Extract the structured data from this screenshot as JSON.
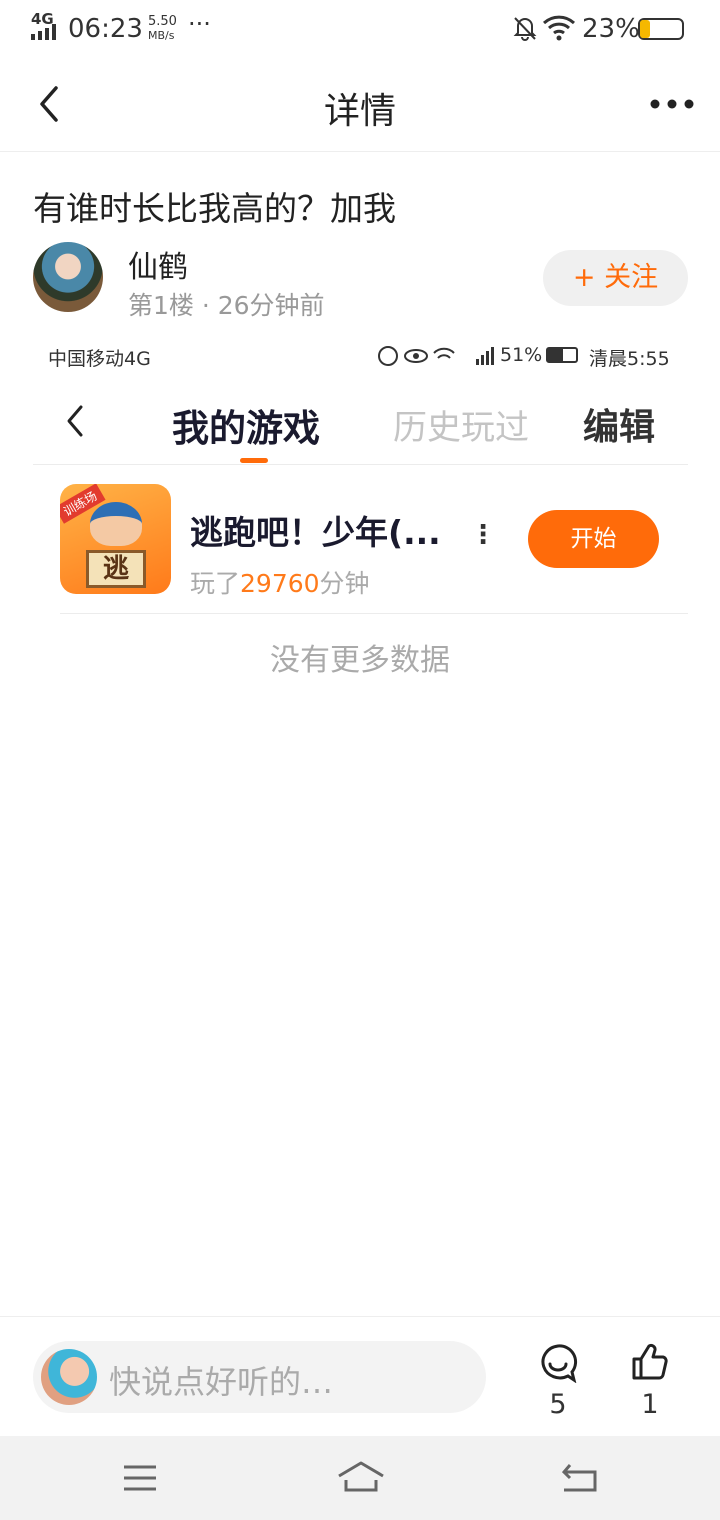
{
  "status_bar": {
    "network": "4G",
    "time": "06:23",
    "speed_value": "5.50",
    "speed_unit": "MB/s",
    "more": "···",
    "battery": "23%",
    "battery_level": 0.23
  },
  "nav": {
    "title": "详情"
  },
  "post": {
    "title": "有谁时长比我高的？加我",
    "author": "仙鹤",
    "meta": "第1楼 · 26分钟前",
    "follow_label": "+ 关注"
  },
  "embedded": {
    "status": {
      "carrier": "中国移动4G",
      "battery": "51%",
      "time": "清晨5:55"
    },
    "tabs": {
      "mine": "我的游戏",
      "history": "历史玩过",
      "edit": "编辑"
    },
    "game": {
      "name": "逃跑吧！少年(...",
      "icon_badge": "训练场",
      "icon_char": "逃",
      "played_prefix": "玩了",
      "played_minutes": "29760",
      "played_suffix": "分钟",
      "start_label": "开始"
    },
    "no_more": "没有更多数据"
  },
  "bottom": {
    "comment_placeholder": "快说点好听的…",
    "comment_count": "5",
    "like_count": "1"
  },
  "colors": {
    "accent": "#ff6b0a",
    "battery_low": "#f5b800"
  }
}
